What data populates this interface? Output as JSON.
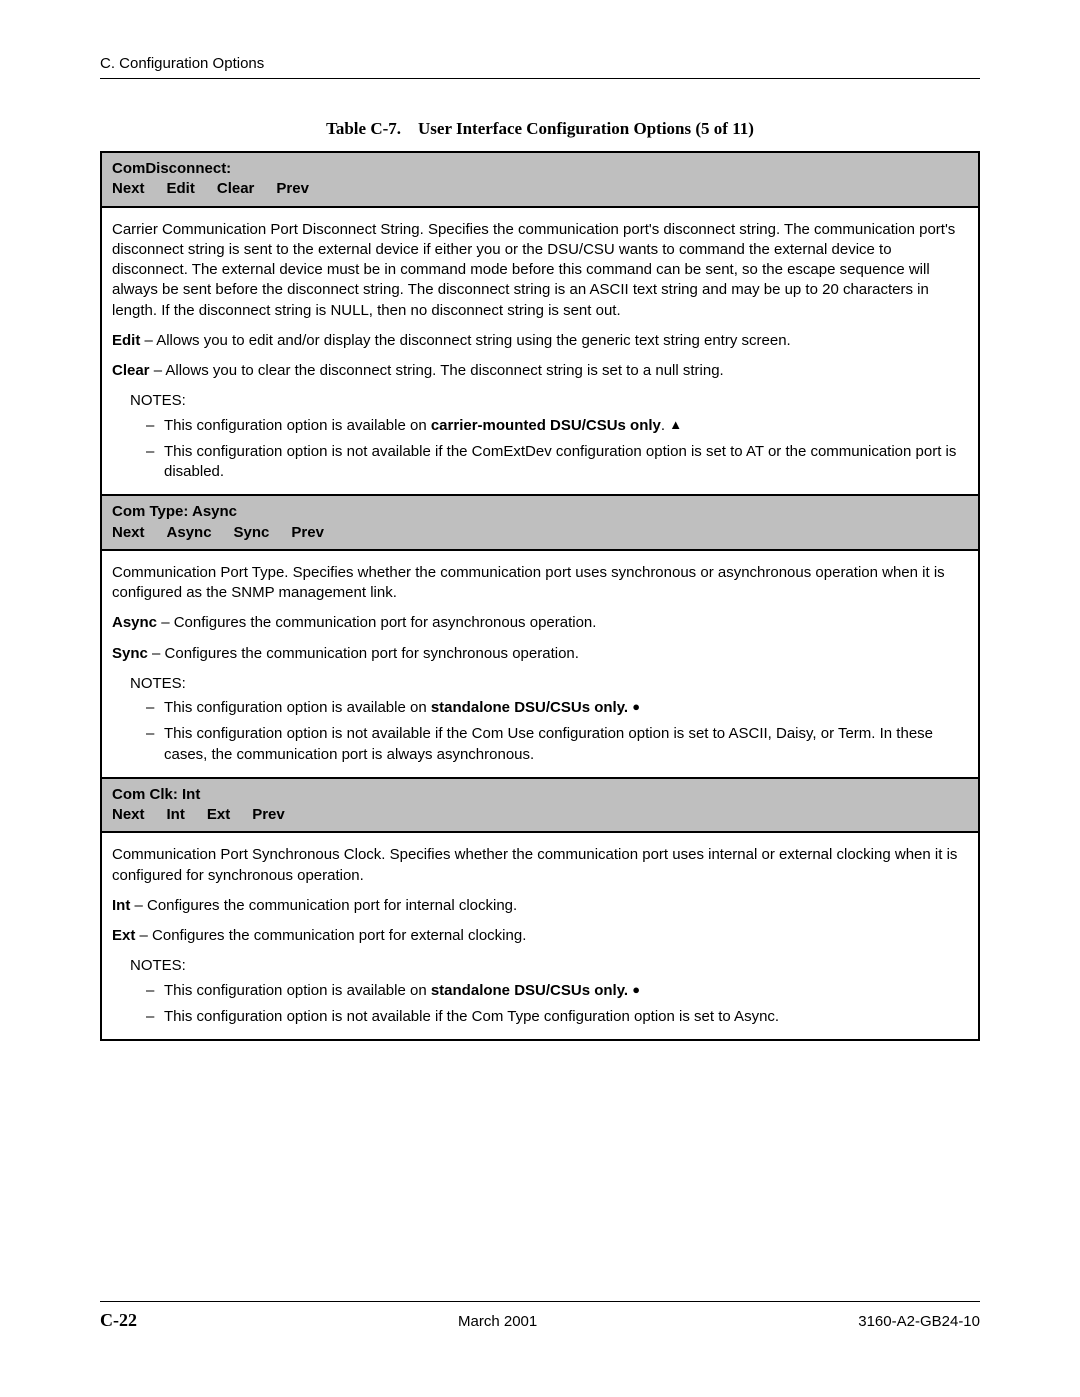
{
  "header": {
    "section": "C. Configuration Options"
  },
  "table": {
    "caption_prefix": "Table C-7.",
    "caption_title": "User Interface Configuration Options (5 of 11)",
    "rows": [
      {
        "type": "header",
        "title": "ComDisconnect:",
        "menu": [
          "Next",
          "Edit",
          "Clear",
          "Prev"
        ]
      },
      {
        "type": "content",
        "paragraphs": [
          {
            "text": "Carrier Communication Port Disconnect String. Specifies the communication port's disconnect string. The communication port's disconnect string is sent to the external device if either you or the DSU/CSU wants to command the external device to disconnect. The external device must be in command mode before this command can be sent, so the escape sequence will always be sent before the disconnect string. The disconnect string is an ASCII text string and may be up to 20 characters in length. If the disconnect string is NULL, then no disconnect string is sent out."
          },
          {
            "bold_prefix": "Edit",
            "text": " – Allows you to edit and/or display the disconnect string using the generic text string entry screen."
          },
          {
            "bold_prefix": "Clear",
            "text": " – Allows you to clear the disconnect string. The disconnect string is set to a null string."
          }
        ],
        "notes_label": "NOTES:",
        "notes": [
          {
            "pre": "This configuration option is available on ",
            "bold": "carrier-mounted DSU/CSUs only",
            "post": ".",
            "symbol": "triangle"
          },
          {
            "pre": "This configuration option is not available if the ComExtDev configuration option is set to AT or the communication port is disabled."
          }
        ]
      },
      {
        "type": "header",
        "title": "Com Type: Async",
        "menu": [
          "Next",
          "Async",
          "Sync",
          "Prev"
        ]
      },
      {
        "type": "content",
        "paragraphs": [
          {
            "text": "Communication Port Type. Specifies whether the communication port uses synchronous or asynchronous operation when it is configured as the SNMP management link."
          },
          {
            "bold_prefix": "Async",
            "text": " – Configures the communication port for asynchronous operation."
          },
          {
            "bold_prefix": "Sync",
            "text": " – Configures the communication port for synchronous operation."
          }
        ],
        "notes_label": "NOTES:",
        "notes": [
          {
            "pre": "This configuration option is available on ",
            "bold": "standalone DSU/CSUs only.",
            "symbol": "circle"
          },
          {
            "pre": "This configuration option is not available if the Com Use configuration option is set to ASCII, Daisy, or Term. In these cases, the communication port is always asynchronous."
          }
        ]
      },
      {
        "type": "header",
        "title": "Com Clk: Int",
        "menu": [
          "Next",
          "Int",
          "Ext",
          "Prev"
        ]
      },
      {
        "type": "content",
        "paragraphs": [
          {
            "text": "Communication Port Synchronous Clock. Specifies whether the communication port uses internal or external clocking when it is configured for synchronous operation."
          },
          {
            "bold_prefix": "Int",
            "text": " – Configures the communication port for internal clocking."
          },
          {
            "bold_prefix": "Ext",
            "text": " – Configures the communication port for external clocking."
          }
        ],
        "notes_label": "NOTES:",
        "notes": [
          {
            "pre": "This configuration option is available on ",
            "bold": "standalone DSU/CSUs only.",
            "symbol": "circle"
          },
          {
            "pre": "This configuration option is not available if the Com Type configuration option is set to Async."
          }
        ]
      }
    ]
  },
  "footer": {
    "page": "C-22",
    "date": "March 2001",
    "doc": "3160-A2-GB24-10"
  }
}
